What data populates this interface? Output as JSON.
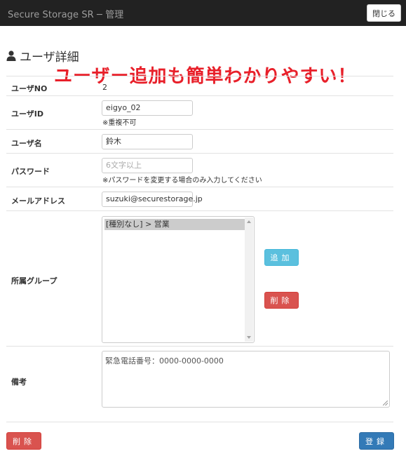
{
  "header": {
    "brand": "Secure Storage SR ─ 管理",
    "close_label": "閉じる"
  },
  "page": {
    "title": "ユーザ詳細",
    "banner": "ユーザー追加も簡単わかりやすい！"
  },
  "form": {
    "user_no": {
      "label": "ユーザNO",
      "value": "2"
    },
    "user_id": {
      "label": "ユーザID",
      "value": "eigyo_02",
      "help": "※重複不可"
    },
    "user_name": {
      "label": "ユーザ名",
      "value": "鈴木"
    },
    "password": {
      "label": "パスワード",
      "placeholder": "6文字以上",
      "help": "※パスワードを変更する場合のみ入力してください"
    },
    "email": {
      "label": "メールアドレス",
      "value": "suzuki@securestorage.jp"
    },
    "groups": {
      "label": "所属グループ",
      "options": [
        "[種別なし] > 営業"
      ],
      "add_label": "追加",
      "remove_label": "削除"
    },
    "notes": {
      "label": "備考",
      "value": "緊急電話番号：0000-0000-0000"
    }
  },
  "footer": {
    "delete_label": "削除",
    "register_label": "登録"
  },
  "colors": {
    "navbar": "#222222",
    "banner_text": "#e8202a",
    "info": "#5bc0de",
    "danger": "#d9534f",
    "primary": "#337ab7"
  },
  "icons": {
    "title_icon": "user-icon"
  }
}
